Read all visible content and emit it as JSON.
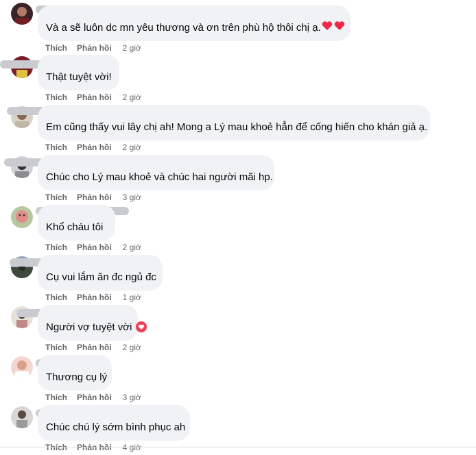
{
  "actions": {
    "like": "Thích",
    "reply": "Phản hồi"
  },
  "comments": [
    {
      "text": "Và a sẽ luôn dc mn yêu thương và ơn trên phù hộ thôi chị ạ.",
      "time": "2 giờ",
      "trailing": "hearts"
    },
    {
      "text": "Thật tuyệt vời!",
      "time": "2 giờ"
    },
    {
      "text": "Em cũng thấy vui lây chị ah! Mong a Lý mau khoẻ hẳn để cống hiến cho khán giả ạ.",
      "time": "2 giờ"
    },
    {
      "text": "Chúc cho Lý mau khoẻ và chúc hai người mãi hp.",
      "time": "3 giờ"
    },
    {
      "text": "Khổ cháu tôi",
      "time": "2 giờ"
    },
    {
      "text": "Cụ vui lắm ăn đc ngủ đc",
      "time": "1 giờ"
    },
    {
      "text": "Người vợ tuyệt vời",
      "time": "2 giờ",
      "trailing": "love-reaction"
    },
    {
      "text": "Thương cụ lý",
      "time": "3 giờ"
    },
    {
      "text": "Chúc chú lý sớm bình phục ah",
      "time": "4 giờ"
    }
  ],
  "colors": {
    "bubble": "#f0f2f5",
    "meta_text": "#65676b",
    "heart": "#f02849"
  },
  "icons": [
    "avatar",
    "heart-emoji",
    "love-reaction-icon"
  ]
}
